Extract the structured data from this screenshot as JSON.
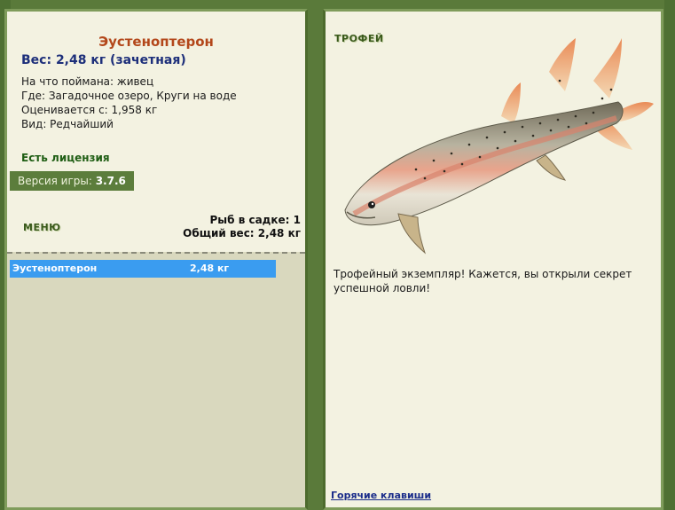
{
  "fish": {
    "name": "Эустеноптерон",
    "weight_line": "Вес: 2,48 кг (зачетная)",
    "bait": "На что поймана: живец",
    "location": "Где: Загадочное озеро, Круги на воде",
    "valued": "Оценивается с: 1,958 кг",
    "kind": "Вид: Редчайший"
  },
  "license": "Есть лицензия",
  "version": {
    "label": "Версия игры:",
    "value": "3.7.6"
  },
  "menu_label": "МЕНЮ",
  "keepnet": {
    "count_line": "Рыб в садке: 1",
    "total_weight_line": "Общий вес: 2,48 кг"
  },
  "catch_list": [
    {
      "name": "Эустеноптерон",
      "weight": "2,48 кг"
    }
  ],
  "trophy": {
    "label": "ТРОФЕЙ",
    "text": "Трофейный экземпляр! Кажется, вы открыли секрет успешной ловли!",
    "image_icon": "fish-image"
  },
  "hotkeys_label": "Горячие клавиши",
  "colors": {
    "frame": "#5a7a3a",
    "panel": "#f3f2e1",
    "fish_name": "#b3471a",
    "weight": "#1d2f7a",
    "selection": "#3a9cf0"
  }
}
